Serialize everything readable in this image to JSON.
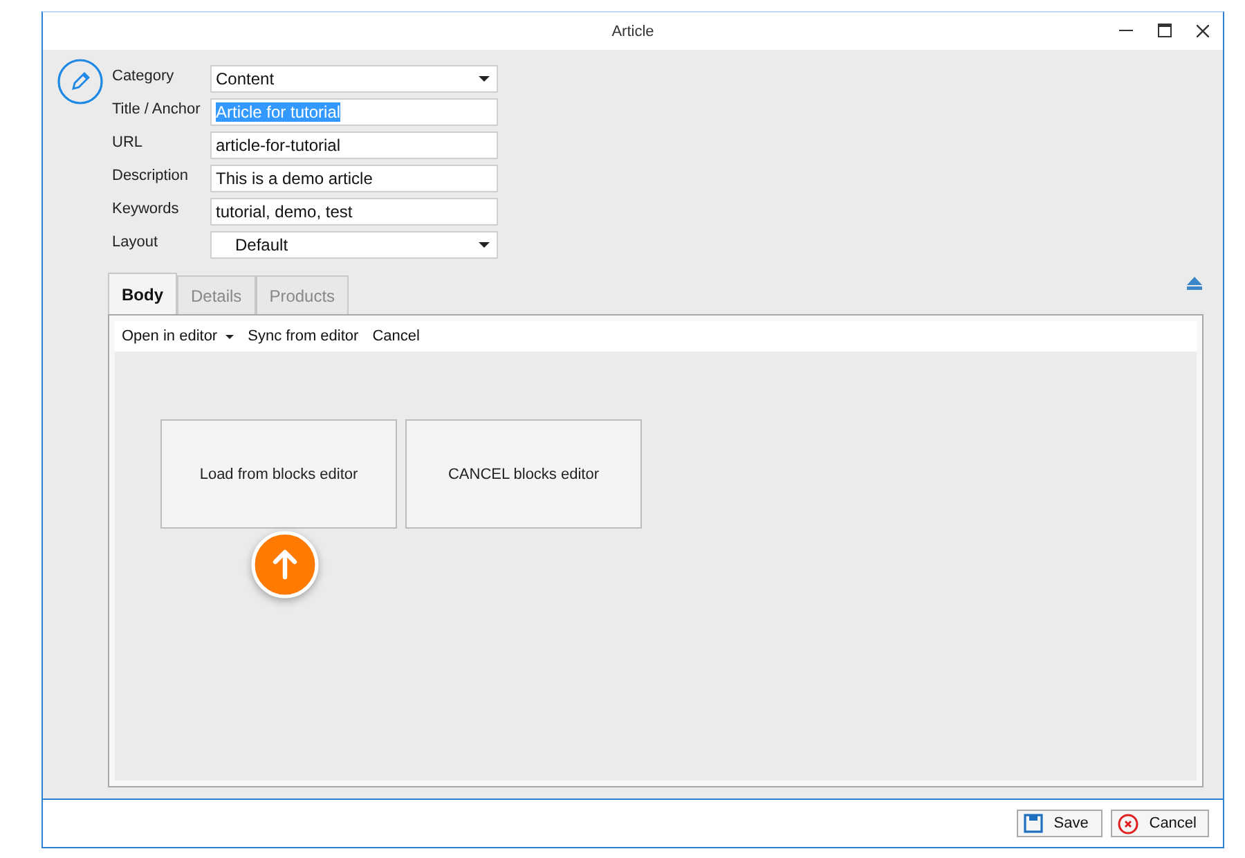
{
  "window": {
    "title": "Article"
  },
  "fields": [
    {
      "label": "Category",
      "kind": "select",
      "value": "Content"
    },
    {
      "label": "Title / Anchor",
      "kind": "text",
      "value": "Article for tutorial",
      "text_selected": true
    },
    {
      "label": "URL",
      "kind": "text",
      "value": "article-for-tutorial",
      "text_selected": false
    },
    {
      "label": "Description",
      "kind": "text",
      "value": "This is a demo article",
      "text_selected": false
    },
    {
      "label": "Keywords",
      "kind": "text",
      "value": "tutorial, demo, test",
      "text_selected": false
    },
    {
      "label": "Layout",
      "kind": "select",
      "value": "Default"
    }
  ],
  "tabs": [
    {
      "label": "Body",
      "selected": true
    },
    {
      "label": "Details",
      "selected": false
    },
    {
      "label": "Products",
      "selected": false
    }
  ],
  "toolbar": [
    {
      "label": "Open in editor",
      "kind": "dropdown"
    },
    {
      "label": "Sync from editor",
      "kind": "button"
    },
    {
      "label": "Cancel",
      "kind": "button"
    }
  ],
  "editor_buttons": [
    "Load from blocks editor",
    "CANCEL blocks editor"
  ],
  "footer_buttons": [
    {
      "label": "Save",
      "kind": "save"
    },
    {
      "label": "Cancel",
      "kind": "cancel"
    }
  ]
}
